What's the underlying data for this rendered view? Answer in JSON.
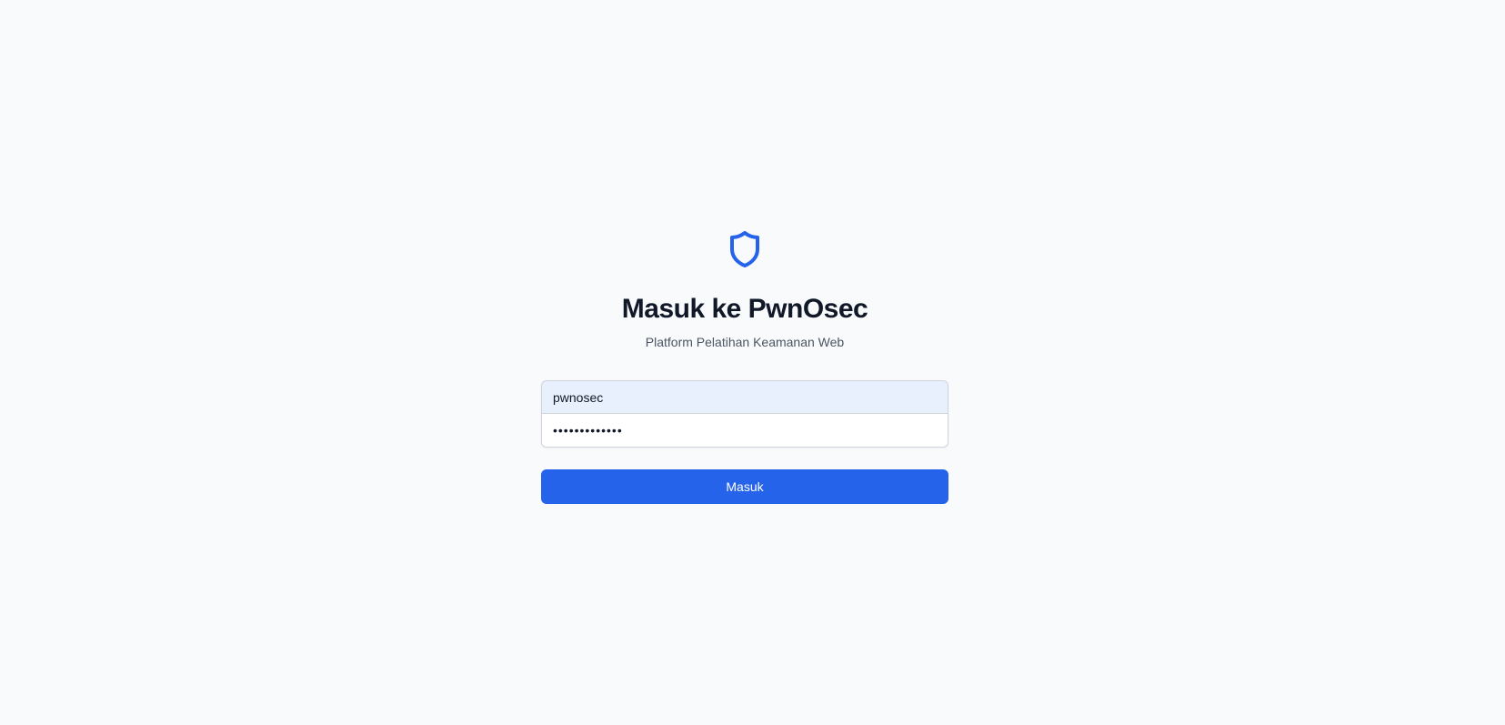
{
  "brand": {
    "icon": "shield-icon",
    "accent_color": "#2563eb"
  },
  "header": {
    "title": "Masuk ke PwnOsec",
    "subtitle": "Platform Pelatihan Keamanan Web"
  },
  "form": {
    "username_value": "pwnosec",
    "password_value": "•••••••••••••",
    "submit_label": "Masuk"
  }
}
